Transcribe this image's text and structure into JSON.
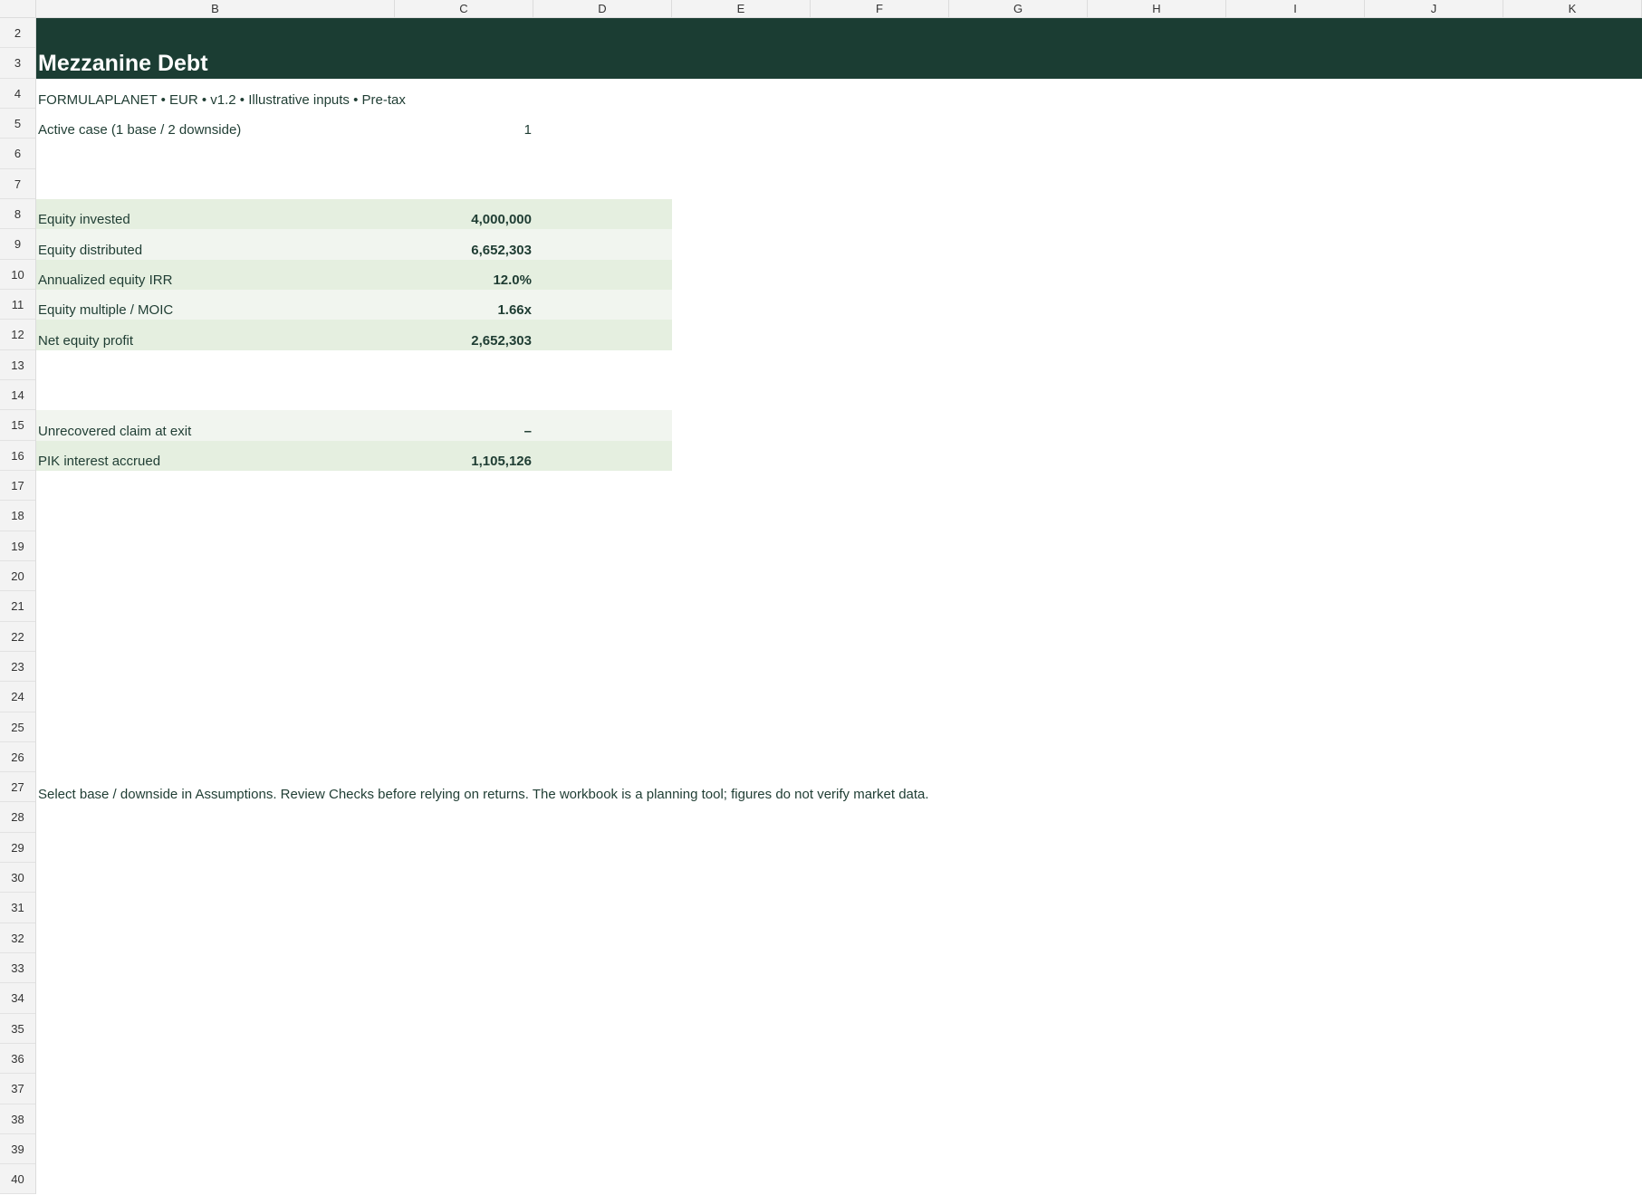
{
  "columns": [
    "B",
    "C",
    "D",
    "E",
    "F",
    "G",
    "H",
    "I",
    "J",
    "K"
  ],
  "rows": [
    "2",
    "3",
    "4",
    "5",
    "6",
    "7",
    "8",
    "9",
    "10",
    "11",
    "12",
    "13",
    "14",
    "15",
    "16",
    "17",
    "18",
    "19",
    "20",
    "21",
    "22",
    "23",
    "24",
    "25",
    "26",
    "27",
    "28",
    "29",
    "30",
    "31",
    "32",
    "33",
    "34",
    "35",
    "36",
    "37",
    "38",
    "39",
    "40"
  ],
  "title": "Mezzanine Debt",
  "meta_line": "FORMULAPLANET  •  EUR  •  v1.2  •  Illustrative inputs  •  Pre-tax",
  "active_case": {
    "label": "Active case (1 base / 2 downside)",
    "value": "1"
  },
  "kpis": [
    {
      "label": "Equity invested",
      "value": "4,000,000"
    },
    {
      "label": "Equity distributed",
      "value": "6,652,303"
    },
    {
      "label": "Annualized equity IRR",
      "value": "12.0%"
    },
    {
      "label": "Equity multiple / MOIC",
      "value": "1.66x"
    },
    {
      "label": "Net equity profit",
      "value": "2,652,303"
    }
  ],
  "claims": [
    {
      "label": "Unrecovered claim at exit",
      "value": "–"
    },
    {
      "label": "PIK interest accrued",
      "value": "1,105,126"
    }
  ],
  "note": "Select base / downside in Assumptions. Review Checks before relying on returns. The workbook is a planning tool; figures do not verify market data.",
  "colors": {
    "title_band": "#1b3d33",
    "shade_a": "#e5efe0",
    "shade_b": "#f1f5ef",
    "text": "#1f3d33"
  }
}
